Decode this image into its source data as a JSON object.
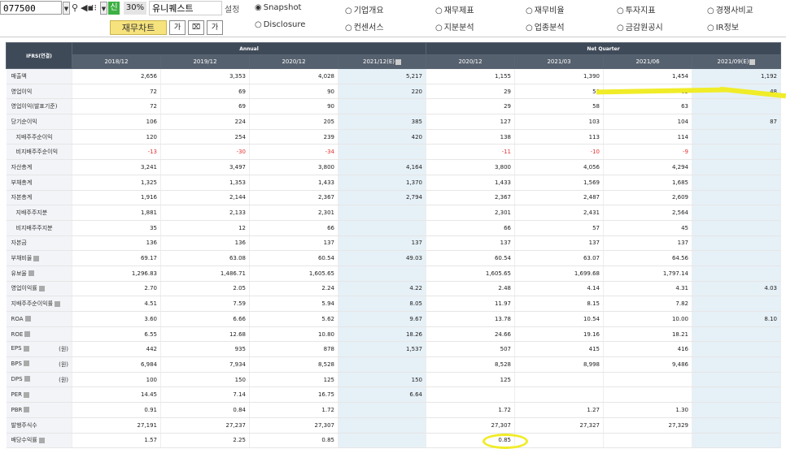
{
  "toolbar": {
    "code": "077500",
    "green_button": "신",
    "zoom": "30%",
    "company": "유니퀘스트",
    "setting": "설정",
    "chart_button": "재무차트",
    "small_btns": [
      "가",
      "⌧",
      "가"
    ]
  },
  "menu": [
    {
      "label": "Snapshot",
      "selected": true
    },
    {
      "label": "기업개요",
      "selected": false
    },
    {
      "label": "재무제표",
      "selected": false
    },
    {
      "label": "재무비율",
      "selected": false
    },
    {
      "label": "투자지표",
      "selected": false
    },
    {
      "label": "경쟁사비교",
      "selected": false
    },
    {
      "label": "Disclosure",
      "selected": false
    },
    {
      "label": "컨센서스",
      "selected": false
    },
    {
      "label": "지분분석",
      "selected": false
    },
    {
      "label": "업종분석",
      "selected": false
    },
    {
      "label": "금감원공시",
      "selected": false
    },
    {
      "label": "IR정보",
      "selected": false
    }
  ],
  "table": {
    "corner": "IFRS(연결)",
    "group_annual": "Annual",
    "group_quarter": "Net Quarter",
    "periods": [
      "2018/12",
      "2019/12",
      "2020/12",
      "2021/12(E)",
      "2020/12",
      "2021/03",
      "2021/06",
      "2021/09(E)"
    ],
    "rows": [
      {
        "label": "매출액",
        "unit": "",
        "sub": false,
        "values": [
          "2,656",
          "3,353",
          "4,028",
          "5,217",
          "1,155",
          "1,390",
          "1,454",
          "1,192"
        ]
      },
      {
        "label": "영업이익",
        "unit": "",
        "sub": false,
        "values": [
          "72",
          "69",
          "90",
          "220",
          "29",
          "58",
          "63",
          "48"
        ]
      },
      {
        "label": "영업이익(발표기준)",
        "unit": "",
        "sub": false,
        "values": [
          "72",
          "69",
          "90",
          "",
          "29",
          "58",
          "63",
          ""
        ]
      },
      {
        "label": "당기순이익",
        "unit": "",
        "sub": false,
        "values": [
          "106",
          "224",
          "205",
          "385",
          "127",
          "103",
          "104",
          "87"
        ]
      },
      {
        "label": "지배주주순이익",
        "unit": "",
        "sub": true,
        "values": [
          "120",
          "254",
          "239",
          "420",
          "138",
          "113",
          "114",
          ""
        ]
      },
      {
        "label": "비지배주주순이익",
        "unit": "",
        "sub": true,
        "values": [
          "-13",
          "-30",
          "-34",
          "",
          "-11",
          "-10",
          "-9",
          ""
        ]
      },
      {
        "label": "자산총계",
        "unit": "",
        "sub": false,
        "values": [
          "3,241",
          "3,497",
          "3,800",
          "4,164",
          "3,800",
          "4,056",
          "4,294",
          ""
        ]
      },
      {
        "label": "부채총계",
        "unit": "",
        "sub": false,
        "values": [
          "1,325",
          "1,353",
          "1,433",
          "1,370",
          "1,433",
          "1,569",
          "1,685",
          ""
        ]
      },
      {
        "label": "자본총계",
        "unit": "",
        "sub": false,
        "values": [
          "1,916",
          "2,144",
          "2,367",
          "2,794",
          "2,367",
          "2,487",
          "2,609",
          ""
        ]
      },
      {
        "label": "지배주주지분",
        "unit": "",
        "sub": true,
        "values": [
          "1,881",
          "2,133",
          "2,301",
          "",
          "2,301",
          "2,431",
          "2,564",
          ""
        ]
      },
      {
        "label": "비지배주주지분",
        "unit": "",
        "sub": true,
        "values": [
          "35",
          "12",
          "66",
          "",
          "66",
          "57",
          "45",
          ""
        ]
      },
      {
        "label": "자본금",
        "unit": "",
        "sub": false,
        "values": [
          "136",
          "136",
          "137",
          "137",
          "137",
          "137",
          "137",
          ""
        ]
      },
      {
        "label": "부채비율",
        "unit": "",
        "sub": false,
        "q": true,
        "values": [
          "69.17",
          "63.08",
          "60.54",
          "49.03",
          "60.54",
          "63.07",
          "64.56",
          ""
        ]
      },
      {
        "label": "유보율",
        "unit": "",
        "sub": false,
        "q": true,
        "values": [
          "1,296.83",
          "1,486.71",
          "1,605.65",
          "",
          "1,605.65",
          "1,699.68",
          "1,797.14",
          ""
        ]
      },
      {
        "label": "영업이익률",
        "unit": "",
        "sub": false,
        "q": true,
        "values": [
          "2.70",
          "2.05",
          "2.24",
          "4.22",
          "2.48",
          "4.14",
          "4.31",
          "4.03"
        ]
      },
      {
        "label": "지배주주순이익률",
        "unit": "",
        "sub": false,
        "q": true,
        "values": [
          "4.51",
          "7.59",
          "5.94",
          "8.05",
          "11.97",
          "8.15",
          "7.82",
          ""
        ]
      },
      {
        "label": "ROA",
        "unit": "",
        "sub": false,
        "q": true,
        "values": [
          "3.60",
          "6.66",
          "5.62",
          "9.67",
          "13.78",
          "10.54",
          "10.00",
          "8.10"
        ]
      },
      {
        "label": "ROE",
        "unit": "",
        "sub": false,
        "q": true,
        "values": [
          "6.55",
          "12.68",
          "10.80",
          "18.26",
          "24.66",
          "19.16",
          "18.21",
          ""
        ]
      },
      {
        "label": "EPS",
        "unit": "(원)",
        "sub": false,
        "q": true,
        "values": [
          "442",
          "935",
          "878",
          "1,537",
          "507",
          "415",
          "416",
          ""
        ]
      },
      {
        "label": "BPS",
        "unit": "(원)",
        "sub": false,
        "q": true,
        "values": [
          "6,984",
          "7,934",
          "8,528",
          "",
          "8,528",
          "8,998",
          "9,486",
          ""
        ]
      },
      {
        "label": "DPS",
        "unit": "(원)",
        "sub": false,
        "q": true,
        "values": [
          "100",
          "150",
          "125",
          "150",
          "125",
          "",
          "",
          ""
        ]
      },
      {
        "label": "PER",
        "unit": "",
        "sub": false,
        "q": true,
        "values": [
          "14.45",
          "7.14",
          "16.75",
          "6.64",
          "",
          "",
          "",
          ""
        ]
      },
      {
        "label": "PBR",
        "unit": "",
        "sub": false,
        "q": true,
        "values": [
          "0.91",
          "0.84",
          "1.72",
          "",
          "1.72",
          "1.27",
          "1.30",
          ""
        ]
      },
      {
        "label": "발행주식수",
        "unit": "",
        "sub": false,
        "values": [
          "27,191",
          "27,237",
          "27,307",
          "",
          "27,307",
          "27,327",
          "27,329",
          ""
        ]
      },
      {
        "label": "배당수익률",
        "unit": "",
        "sub": false,
        "q": true,
        "values": [
          "1.57",
          "2.25",
          "0.85",
          "",
          "0.85",
          "",
          "",
          ""
        ]
      }
    ]
  },
  "colors": {
    "header_dark": "#3f4a59",
    "estimate_bg": "#e6f0f7",
    "negative": "#e53131",
    "highlight": "#f0ec28"
  }
}
